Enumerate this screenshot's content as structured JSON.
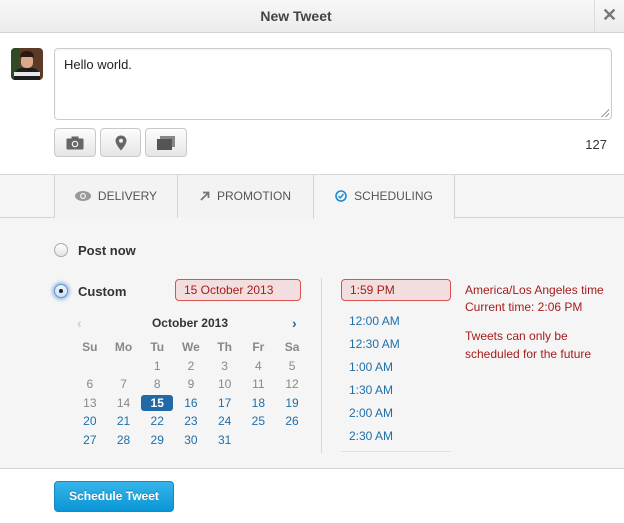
{
  "header": {
    "title": "New Tweet",
    "close_label": "✕",
    "close_icon": "close-icon"
  },
  "compose": {
    "avatar": "user-avatar",
    "text": "Hello world.",
    "char_count": "127",
    "toolbar": [
      {
        "icon": "camera-icon",
        "label": "Add photo"
      },
      {
        "icon": "location-pin-icon",
        "label": "Add location"
      },
      {
        "icon": "multiple-windows-icon",
        "label": "Multiple accounts"
      }
    ]
  },
  "tabs": [
    {
      "label": "DELIVERY",
      "icon": "eye-icon",
      "active": false
    },
    {
      "label": "PROMOTION",
      "icon": "arrow-up-right-icon",
      "active": false
    },
    {
      "label": "SCHEDULING",
      "icon": "clock-icon",
      "active": true
    }
  ],
  "scheduling": {
    "options": [
      {
        "label": "Post now",
        "checked": false
      },
      {
        "label": "Custom",
        "checked": true
      }
    ],
    "date_value": "15 October 2013",
    "time_value": "1:59 PM",
    "calendar": {
      "title": "October 2013",
      "prev_label": "‹",
      "next_label": "›",
      "weekdays": [
        "Su",
        "Mo",
        "Tu",
        "We",
        "Th",
        "Fr",
        "Sa"
      ],
      "selected_day": 15,
      "weeks": [
        [
          "",
          "",
          "1",
          "2",
          "3",
          "4",
          "5"
        ],
        [
          "6",
          "7",
          "8",
          "9",
          "10",
          "11",
          "12"
        ],
        [
          "13",
          "14",
          "15",
          "16",
          "17",
          "18",
          "19"
        ],
        [
          "20",
          "21",
          "22",
          "23",
          "24",
          "25",
          "26"
        ],
        [
          "27",
          "28",
          "29",
          "30",
          "31",
          "",
          ""
        ]
      ]
    },
    "time_options": [
      "12:00 AM",
      "12:30 AM",
      "1:00 AM",
      "1:30 AM",
      "2:00 AM",
      "2:30 AM"
    ],
    "timezone": "America/Los Angeles time",
    "current_time": "Current time: 2:06 PM",
    "warning": "Tweets can only be scheduled for the future"
  },
  "colors": {
    "accent": "#1f6fa8",
    "error": "#a61c1c",
    "error_bg": "#f2dede",
    "primary_button": "#0a96d6"
  },
  "footer": {
    "submit_label": "Schedule Tweet"
  }
}
